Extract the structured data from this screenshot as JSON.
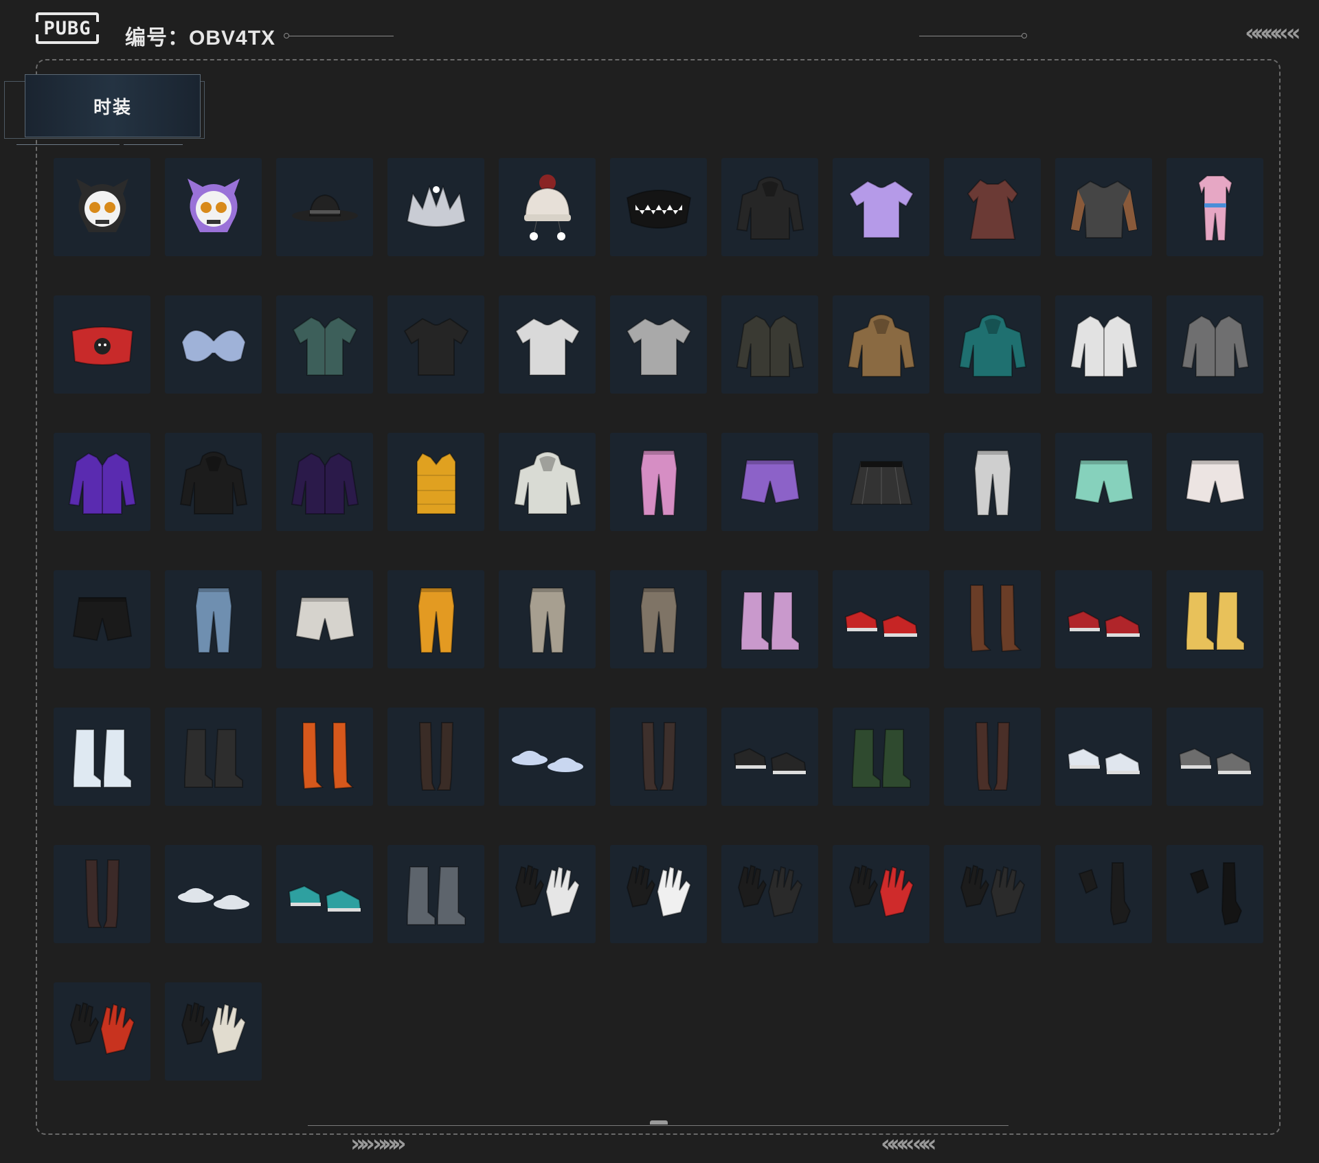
{
  "header": {
    "logo_text": "PUBG",
    "serial_text": "编号：OBV4TX"
  },
  "tab": {
    "label": "时装"
  },
  "items": [
    {
      "name": "skull-mask-black-icon",
      "kind": "skull",
      "color": "#2b2b2b"
    },
    {
      "name": "skull-mask-purple-icon",
      "kind": "skull",
      "color": "#9a72d8"
    },
    {
      "name": "fedora-hat-icon",
      "kind": "hat",
      "color": "#222222"
    },
    {
      "name": "silver-crown-icon",
      "kind": "crown",
      "color": "#c9ccd4"
    },
    {
      "name": "beanie-hat-icon",
      "kind": "beanie",
      "color": "#e7e0d8"
    },
    {
      "name": "shark-face-mask-icon",
      "kind": "mask",
      "color": "#141414"
    },
    {
      "name": "black-graphic-hoodie-icon",
      "kind": "hoodie",
      "color": "#262626"
    },
    {
      "name": "purple-tshirt-icon",
      "kind": "tshirt",
      "color": "#b59ae8"
    },
    {
      "name": "floral-dress-icon",
      "kind": "dress",
      "color": "#6b3a35"
    },
    {
      "name": "tattoo-sleeve-shirt-icon",
      "kind": "longsleeve",
      "color": "#454545"
    },
    {
      "name": "pink-jumpsuit-icon",
      "kind": "jumpsuit",
      "color": "#e6a7c4"
    },
    {
      "name": "red-crop-top-icon",
      "kind": "crop",
      "color": "#c82a2a"
    },
    {
      "name": "blue-floral-bra-icon",
      "kind": "bra",
      "color": "#9fb2d8"
    },
    {
      "name": "hawaiian-shirt-icon",
      "kind": "shirt",
      "color": "#3d5f5a"
    },
    {
      "name": "black-graphic-tshirt-icon",
      "kind": "tshirt",
      "color": "#252525"
    },
    {
      "name": "white-tshirt-icon",
      "kind": "tshirt",
      "color": "#d9d9d9"
    },
    {
      "name": "grey-tshirt-icon",
      "kind": "tshirt",
      "color": "#a9a9a9"
    },
    {
      "name": "leather-vest-jacket-icon",
      "kind": "jacket",
      "color": "#3a3a33"
    },
    {
      "name": "dog-ear-hoodie-icon",
      "kind": "hoodie",
      "color": "#8a6a42"
    },
    {
      "name": "teal-hooded-jacket-icon",
      "kind": "hoodie",
      "color": "#1f7070"
    },
    {
      "name": "white-print-jacket-icon",
      "kind": "jacket",
      "color": "#e2e2e2"
    },
    {
      "name": "grey-orange-jacket-icon",
      "kind": "jacket",
      "color": "#6f6f70"
    },
    {
      "name": "purple-racing-jacket-icon",
      "kind": "jacket",
      "color": "#5a2bb0"
    },
    {
      "name": "black-checkered-hoodie-icon",
      "kind": "hoodie",
      "color": "#1c1c1c"
    },
    {
      "name": "purple-black-jacket-icon",
      "kind": "jacket",
      "color": "#2b1a4a"
    },
    {
      "name": "yellow-puffer-vest-icon",
      "kind": "vest",
      "color": "#e0a120"
    },
    {
      "name": "white-leaf-hoodie-icon",
      "kind": "hoodie",
      "color": "#d9dbd4"
    },
    {
      "name": "pink-pants-icon",
      "kind": "pants",
      "color": "#d68ec4"
    },
    {
      "name": "purple-shorts-icon",
      "kind": "shorts",
      "color": "#8c62c8"
    },
    {
      "name": "plaid-skirt-icon",
      "kind": "skirt",
      "color": "#333333"
    },
    {
      "name": "white-sweatpants-icon",
      "kind": "pants",
      "color": "#cfcfcf"
    },
    {
      "name": "mint-ruffle-shorts-icon",
      "kind": "shorts",
      "color": "#86d1bc"
    },
    {
      "name": "white-ruffle-shorts-icon",
      "kind": "shorts",
      "color": "#ece4e2"
    },
    {
      "name": "black-leather-shorts-icon",
      "kind": "shorts",
      "color": "#1a1a1a"
    },
    {
      "name": "ripped-jeans-icon",
      "kind": "pants",
      "color": "#6f8fb0"
    },
    {
      "name": "white-denim-shorts-icon",
      "kind": "shorts",
      "color": "#d6d3cd"
    },
    {
      "name": "yellow-jogger-pants-icon",
      "kind": "pants",
      "color": "#e39a22"
    },
    {
      "name": "khaki-cargo-pants-icon",
      "kind": "pants",
      "color": "#a79f90"
    },
    {
      "name": "taupe-cargo-pants-icon",
      "kind": "pants",
      "color": "#7f7466"
    },
    {
      "name": "pink-platform-boots-icon",
      "kind": "boots",
      "color": "#c999cc"
    },
    {
      "name": "red-sneakers-icon",
      "kind": "shoes",
      "color": "#c62525"
    },
    {
      "name": "brown-tall-boots-icon",
      "kind": "tallboots",
      "color": "#6a3d27"
    },
    {
      "name": "red-high-top-sneakers-icon",
      "kind": "shoes",
      "color": "#b0252a"
    },
    {
      "name": "yellow-fluffy-boots-icon",
      "kind": "boots",
      "color": "#e8c15a"
    },
    {
      "name": "white-fluffy-boots-icon",
      "kind": "boots",
      "color": "#dfe9f2"
    },
    {
      "name": "black-fluffy-boots-icon",
      "kind": "boots",
      "color": "#2d2d2d"
    },
    {
      "name": "orange-thigh-boots-icon",
      "kind": "tallboots",
      "color": "#d6581c"
    },
    {
      "name": "fishnet-stockings-icon",
      "kind": "legs",
      "color": "#3a2c26"
    },
    {
      "name": "blue-sandals-icon",
      "kind": "sandals",
      "color": "#c9d7f0"
    },
    {
      "name": "dotted-stockings-heels-icon",
      "kind": "legs",
      "color": "#3e302c"
    },
    {
      "name": "black-red-shoes-icon",
      "kind": "shoes",
      "color": "#262626"
    },
    {
      "name": "green-combat-boots-icon",
      "kind": "boots",
      "color": "#2f4a2f"
    },
    {
      "name": "brown-stockings-icon",
      "kind": "legs",
      "color": "#4a2f28"
    },
    {
      "name": "blue-white-sneakers-icon",
      "kind": "shoes",
      "color": "#e0e6ee"
    },
    {
      "name": "grey-orange-sneakers-icon",
      "kind": "shoes",
      "color": "#6d6d6d"
    },
    {
      "name": "sheer-stockings-boots-icon",
      "kind": "legs",
      "color": "#3c2a28"
    },
    {
      "name": "white-slides-icon",
      "kind": "sandals",
      "color": "#dfe4ea"
    },
    {
      "name": "teal-clogs-icon",
      "kind": "shoes",
      "color": "#2ea0a0"
    },
    {
      "name": "grey-worn-boots-icon",
      "kind": "boots",
      "color": "#5d646c"
    },
    {
      "name": "black-white-gloves-icon",
      "kind": "gloves",
      "color": "#e6e6e6"
    },
    {
      "name": "red-white-gloves-icon",
      "kind": "gloves",
      "color": "#f0f0f0"
    },
    {
      "name": "studded-black-gloves-icon",
      "kind": "gloves",
      "color": "#2a2a2a"
    },
    {
      "name": "red-fingerless-gloves-icon",
      "kind": "gloves",
      "color": "#cf2b2b"
    },
    {
      "name": "gold-trim-gloves-icon",
      "kind": "gloves",
      "color": "#2b2b2b"
    },
    {
      "name": "black-long-gloves-icon",
      "kind": "longgloves",
      "color": "#1c1c1c"
    },
    {
      "name": "black-arm-warmers-icon",
      "kind": "longgloves",
      "color": "#141414"
    },
    {
      "name": "red-racing-gloves-icon",
      "kind": "gloves",
      "color": "#c8331f"
    },
    {
      "name": "cotton-work-gloves-icon",
      "kind": "gloves",
      "color": "#e1dccf"
    }
  ],
  "decor": {
    "left_chevrons": "»» »»»",
    "right_chevrons": "««« ««",
    "top_chevrons": "«««« «"
  }
}
